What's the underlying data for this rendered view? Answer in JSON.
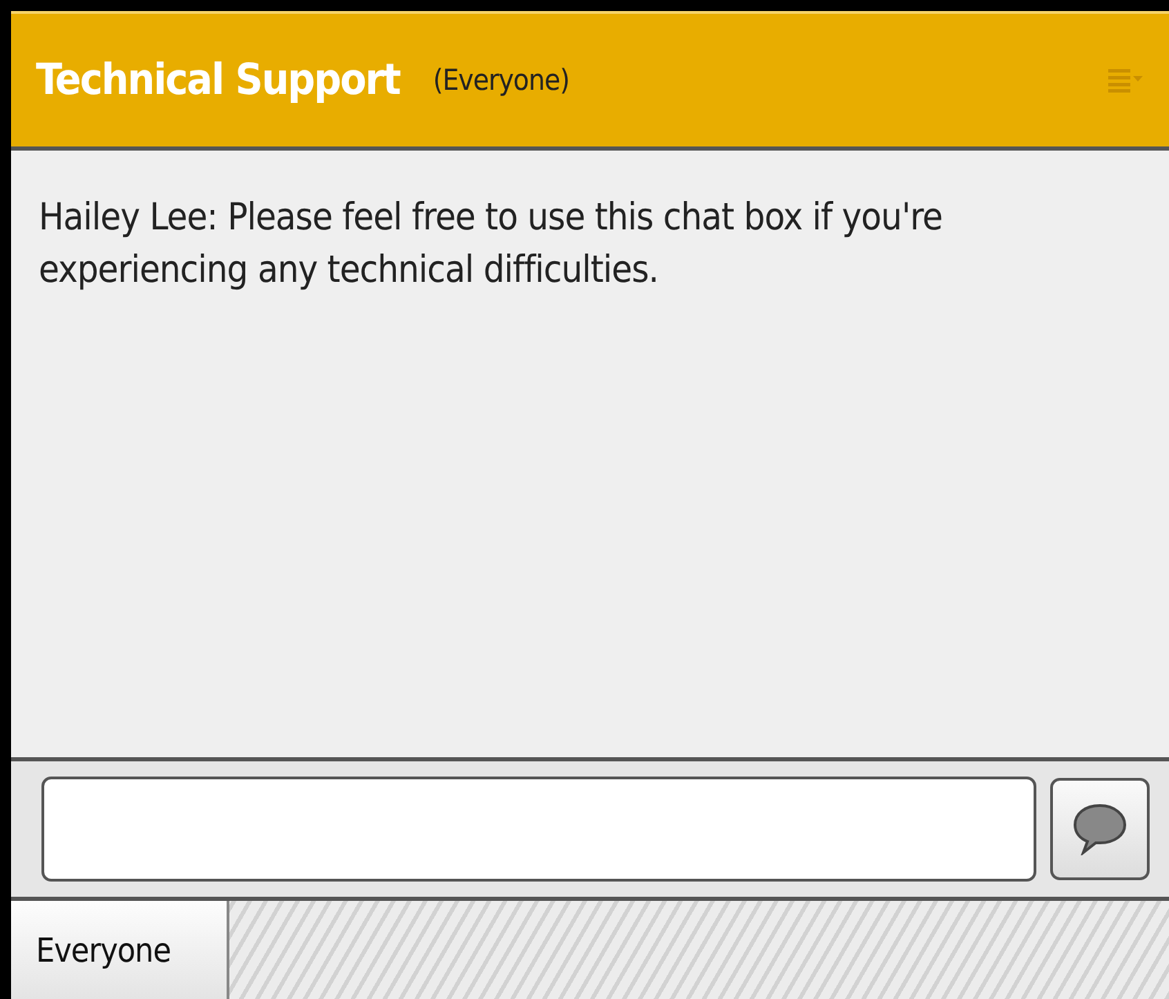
{
  "header": {
    "title": "Technical Support",
    "audience": "(Everyone)"
  },
  "messages": [
    {
      "sender": "Hailey Lee:",
      "text": "Please feel free to use this chat box if you're experiencing any technical difficulties."
    }
  ],
  "tabs": [
    {
      "label": "Everyone",
      "selected": true
    }
  ]
}
